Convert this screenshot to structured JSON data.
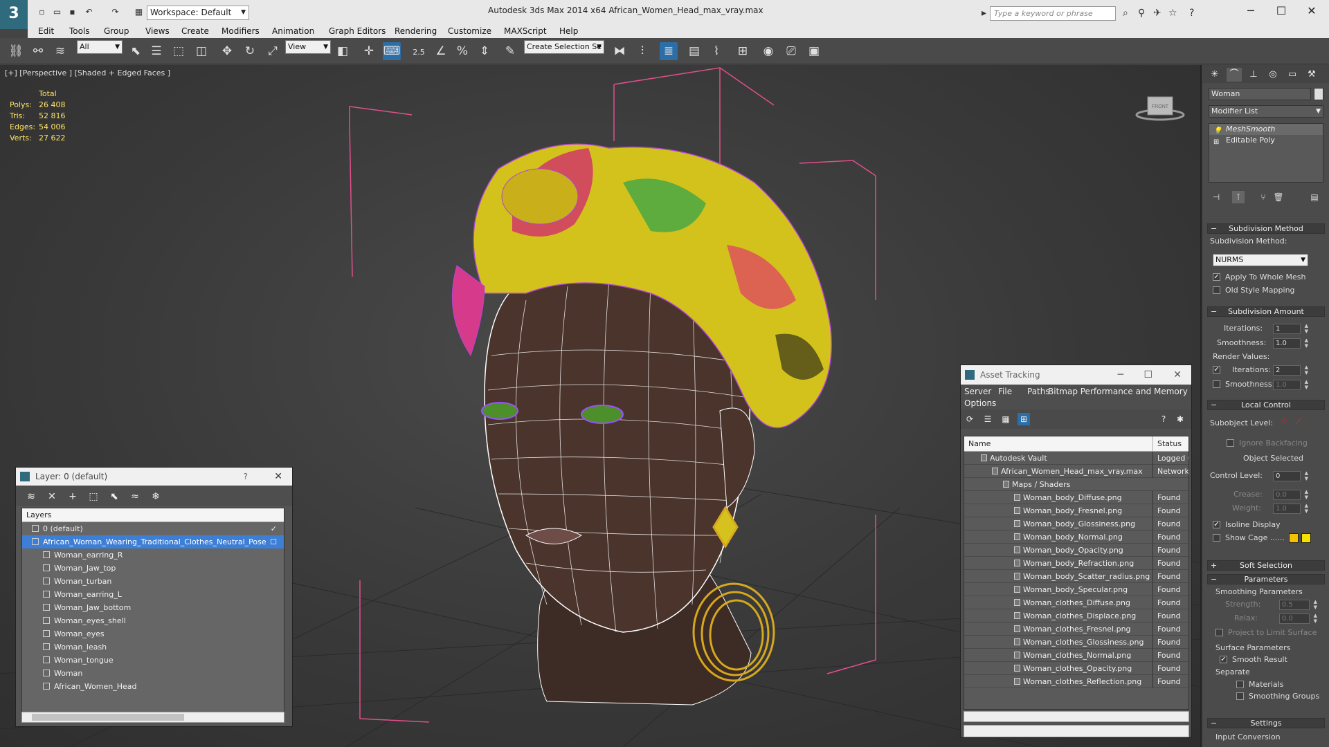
{
  "window": {
    "app_title": "Autodesk 3ds Max  2014 x64      African_Women_Head_max_vray.max",
    "workspace": "Workspace: Default",
    "search_placeholder": "Type a keyword or phrase"
  },
  "menu": [
    "Edit",
    "Tools",
    "Group",
    "Views",
    "Create",
    "Modifiers",
    "Animation",
    "Graph Editors",
    "Rendering",
    "Customize",
    "MAXScript",
    "Help"
  ],
  "toolbar": {
    "filter_select": "All",
    "ref_coord_select": "View",
    "snap_label": "2.5",
    "named_selection": "Create Selection Se"
  },
  "viewport": {
    "label": "[+] [Perspective ] [Shaded + Edged Faces ]",
    "stats_header": "Total",
    "stats": [
      {
        "k": "Polys:",
        "v": "26 408"
      },
      {
        "k": "Tris:",
        "v": "52 816"
      },
      {
        "k": "Edges:",
        "v": "54 006"
      },
      {
        "k": "Verts:",
        "v": "27 622"
      }
    ],
    "view_cube_label": "FRONT"
  },
  "layer_panel": {
    "title": "Layer: 0 (default)",
    "help": "?",
    "column_header": "Layers",
    "rows": [
      {
        "name": "0 (default)",
        "indent": 14,
        "checked": true,
        "selected": false
      },
      {
        "name": "African_Woman_Wearing_Traditional_Clothes_Neutral_Pose",
        "indent": 14,
        "checked": false,
        "selected": true
      },
      {
        "name": "Woman_earring_R",
        "indent": 30,
        "checked": false,
        "selected": false
      },
      {
        "name": "Woman_Jaw_top",
        "indent": 30,
        "checked": false,
        "selected": false
      },
      {
        "name": "Woman_turban",
        "indent": 30,
        "checked": false,
        "selected": false
      },
      {
        "name": "Woman_earring_L",
        "indent": 30,
        "checked": false,
        "selected": false
      },
      {
        "name": "Woman_Jaw_bottom",
        "indent": 30,
        "checked": false,
        "selected": false
      },
      {
        "name": "Woman_eyes_shell",
        "indent": 30,
        "checked": false,
        "selected": false
      },
      {
        "name": "Woman_eyes",
        "indent": 30,
        "checked": false,
        "selected": false
      },
      {
        "name": "Woman_leash",
        "indent": 30,
        "checked": false,
        "selected": false
      },
      {
        "name": "Woman_tongue",
        "indent": 30,
        "checked": false,
        "selected": false
      },
      {
        "name": "Woman",
        "indent": 30,
        "checked": false,
        "selected": false
      },
      {
        "name": "African_Women_Head",
        "indent": 30,
        "checked": false,
        "selected": false
      }
    ]
  },
  "asset_panel": {
    "title": "Asset Tracking",
    "menu": [
      "Server",
      "File",
      "Paths",
      "Bitmap Performance and Memory",
      "Options"
    ],
    "col_name": "Name",
    "col_status": "Status",
    "rows": [
      {
        "name": "Autodesk Vault",
        "indent": 30,
        "status": "Logged O"
      },
      {
        "name": "African_Women_Head_max_vray.max",
        "indent": 46,
        "status": "Network P"
      },
      {
        "name": "Maps / Shaders",
        "indent": 62,
        "status": ""
      },
      {
        "name": "Woman_body_Diffuse.png",
        "indent": 78,
        "status": "Found"
      },
      {
        "name": "Woman_body_Fresnel.png",
        "indent": 78,
        "status": "Found"
      },
      {
        "name": "Woman_body_Glossiness.png",
        "indent": 78,
        "status": "Found"
      },
      {
        "name": "Woman_body_Normal.png",
        "indent": 78,
        "status": "Found"
      },
      {
        "name": "Woman_body_Opacity.png",
        "indent": 78,
        "status": "Found"
      },
      {
        "name": "Woman_body_Refraction.png",
        "indent": 78,
        "status": "Found"
      },
      {
        "name": "Woman_body_Scatter_radius.png",
        "indent": 78,
        "status": "Found"
      },
      {
        "name": "Woman_body_Specular.png",
        "indent": 78,
        "status": "Found"
      },
      {
        "name": "Woman_clothes_Diffuse.png",
        "indent": 78,
        "status": "Found"
      },
      {
        "name": "Woman_clothes_Displace.png",
        "indent": 78,
        "status": "Found"
      },
      {
        "name": "Woman_clothes_Fresnel.png",
        "indent": 78,
        "status": "Found"
      },
      {
        "name": "Woman_clothes_Glossiness.png",
        "indent": 78,
        "status": "Found"
      },
      {
        "name": "Woman_clothes_Normal.png",
        "indent": 78,
        "status": "Found"
      },
      {
        "name": "Woman_clothes_Opacity.png",
        "indent": 78,
        "status": "Found"
      },
      {
        "name": "Woman_clothes_Reflection.png",
        "indent": 78,
        "status": "Found"
      }
    ]
  },
  "command_panel": {
    "object_name": "Woman",
    "modifier_list": "Modifier List",
    "stack": [
      "MeshSmooth",
      "Editable Poly"
    ],
    "subdivision_method_head": "Subdivision Method",
    "subdivision_method_label": "Subdivision Method:",
    "subdivision_method_value": "NURMS",
    "apply_whole_mesh": "Apply To Whole Mesh",
    "old_style_mapping": "Old Style Mapping",
    "subdivision_amount_head": "Subdivision Amount",
    "iterations_label": "Iterations:",
    "iterations_value": "1",
    "smoothness_label": "Smoothness:",
    "smoothness_value": "1.0",
    "render_values": "Render Values:",
    "render_iterations_label": "Iterations:",
    "render_iterations_value": "2",
    "render_smoothness_label": "Smoothness:",
    "render_smoothness_value": "1.0",
    "local_control_head": "Local Control",
    "subobject_level": "Subobject Level:",
    "ignore_backfacing": "Ignore Backfacing",
    "object_selected": "Object Selected",
    "control_level_label": "Control Level:",
    "control_level_value": "0",
    "crease_label": "Crease:",
    "crease_value": "0.0",
    "weight_label": "Weight:",
    "weight_value": "1.0",
    "isoline_display": "Isoline Display",
    "show_cage": "Show Cage ......",
    "cage_color_1": "#f2c200",
    "cage_color_2": "#f5e000",
    "soft_selection_head": "Soft Selection",
    "parameters_head": "Parameters",
    "smoothing_parameters": "Smoothing Parameters",
    "strength_label": "Strength:",
    "strength_value": "0.5",
    "relax_label": "Relax:",
    "relax_value": "0.0",
    "project_limit": "Project to Limit Surface",
    "surface_parameters": "Surface Parameters",
    "smooth_result": "Smooth Result",
    "separate": "Separate",
    "materials": "Materials",
    "smoothing_groups": "Smoothing Groups",
    "settings_head": "Settings",
    "input_conversion": "Input Conversion"
  },
  "colors": {
    "stats_yellow": "#ffe566",
    "selection_blue": "#3d7fd6",
    "gizmo_pink": "#e0508a"
  }
}
